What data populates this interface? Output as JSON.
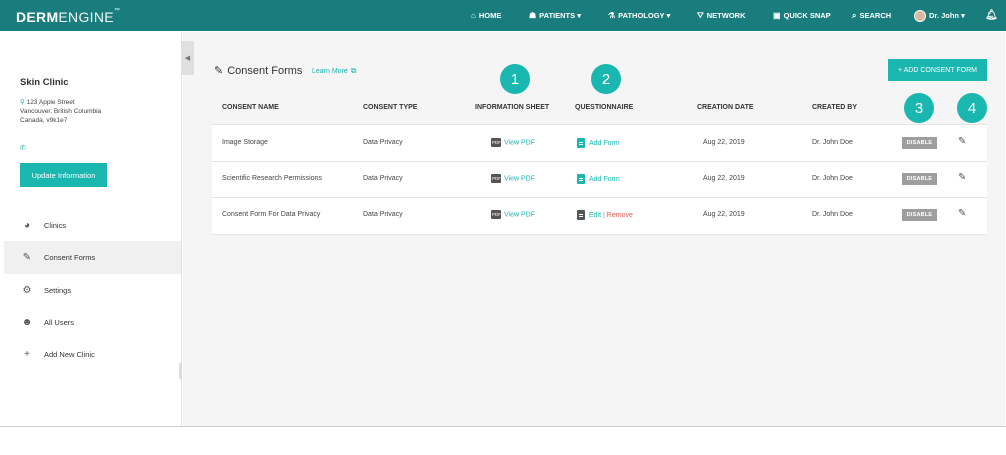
{
  "brand": {
    "bold": "DERM",
    "light": "ENGINE",
    "mark": "™"
  },
  "nav": {
    "home": "HOME",
    "patients": "PATIENTS ▾",
    "pathology": "PATHOLOGY ▾",
    "network": "NETWORK",
    "quick_snap": "QUICK SNAP",
    "search": "SEARCH",
    "user": "Dr. John ▾"
  },
  "sidebar": {
    "clinic_name": "Skin Clinic",
    "address_line1": "123 Apple Street",
    "address_line2": "Vancouver, British Columbia",
    "address_line3": "Canada, v9k1e7",
    "update_label": "Update Information",
    "items": [
      {
        "label": "Clinics",
        "icon": "pie-chart-icon"
      },
      {
        "label": "Consent Forms",
        "icon": "edit-form-icon"
      },
      {
        "label": "Settings",
        "icon": "gear-icon"
      },
      {
        "label": "All Users",
        "icon": "users-icon"
      },
      {
        "label": "Add New Clinic",
        "icon": "plus-icon"
      }
    ]
  },
  "main": {
    "title": "Consent Forms",
    "learn_more": "Learn More",
    "add_button": "+ ADD CONSENT FORM",
    "badges": [
      "1",
      "2",
      "3",
      "4"
    ],
    "columns": [
      "CONSENT NAME",
      "CONSENT TYPE",
      "INFORMATION SHEET",
      "QUESTIONNAIRE",
      "CREATION DATE",
      "CREATED BY"
    ],
    "rows": [
      {
        "name": "Image Storage",
        "type": "Data Privacy",
        "info": "View PDF",
        "q_add": "Add Form",
        "date": "Aug 22, 2019",
        "by": "Dr. John Doe",
        "action": "DISABLE"
      },
      {
        "name": "Scientific Research Permissions",
        "type": "Data Privacy",
        "info": "View PDF",
        "q_add": "Add Form",
        "date": "Aug 22, 2019",
        "by": "Dr. John Doe",
        "action": "DISABLE"
      },
      {
        "name": "Consent Form For Data Privacy",
        "type": "Data Privacy",
        "info": "View PDF",
        "q_edit": "Edit",
        "q_sep": "|",
        "q_remove": "Remove",
        "date": "Aug 22, 2019",
        "by": "Dr. John Doe",
        "action": "DISABLE"
      }
    ]
  },
  "colors": {
    "topbar": "#1a7d7d",
    "accent": "#1ab6b0",
    "remove": "#e05a4e",
    "disable": "#9e9e9e"
  }
}
